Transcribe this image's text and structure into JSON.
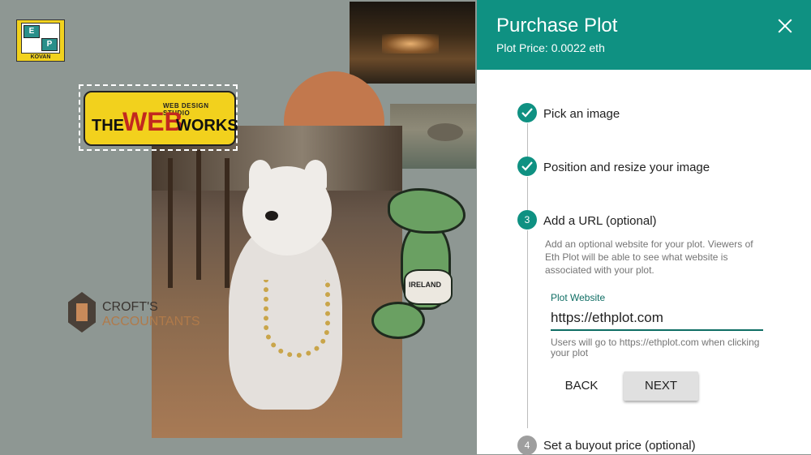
{
  "app_logo": {
    "cells": [
      "E",
      "P"
    ],
    "network": "KOVAN"
  },
  "canvas": {
    "webworks": {
      "the": "THE",
      "web": "WEB",
      "works": "WORKS",
      "tagline": "WEB DESIGN STUDIO"
    },
    "crofts": {
      "line1": "CROFT'S",
      "line2": "ACCOUNTANTS"
    },
    "dino": {
      "shirt_text": "IRELAND"
    }
  },
  "panel": {
    "title": "Purchase Plot",
    "price": "Plot Price: 0.0022 eth",
    "steps": [
      {
        "number": "1",
        "label": "Pick an image",
        "status": "complete"
      },
      {
        "number": "2",
        "label": "Position and resize your image",
        "status": "complete"
      },
      {
        "number": "3",
        "label": "Add a URL (optional)",
        "status": "active"
      },
      {
        "number": "4",
        "label": "Set a buyout price (optional)",
        "status": "todo"
      }
    ],
    "step3": {
      "description": "Add an optional website for your plot. Viewers of Eth Plot will be able to see what website is associated with your plot.",
      "field_label": "Plot Website",
      "field_value": "https://ethplot.com",
      "help_text": "Users will go to https://ethplot.com when clicking your plot",
      "back_label": "BACK",
      "next_label": "NEXT"
    }
  },
  "colors": {
    "accent": "#0f9182",
    "accent_dark": "#0f6e64",
    "canvas_bg": "#8e9793",
    "step_todo": "#9e9e9e"
  }
}
